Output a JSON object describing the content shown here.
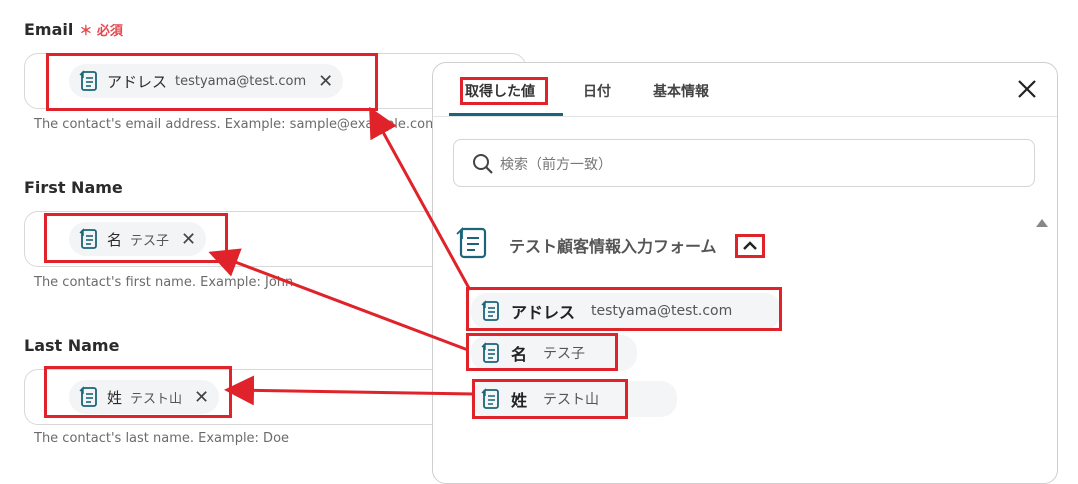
{
  "form": {
    "email": {
      "label": "Email",
      "required_mark": "＊ 必須",
      "chip_name": "アドレス",
      "chip_value": "testyama@test.com",
      "help": "The contact's email address. Example: sample@example.com"
    },
    "first_name": {
      "label": "First Name",
      "chip_name": "名",
      "chip_value": "テス子",
      "help": "The contact's first name. Example: John"
    },
    "last_name": {
      "label": "Last Name",
      "chip_name": "姓",
      "chip_value": "テスト山",
      "help": "The contact's last name. Example: Doe"
    }
  },
  "panel": {
    "tabs": [
      {
        "label": "取得した値",
        "active": true
      },
      {
        "label": "日付",
        "active": false
      },
      {
        "label": "基本情報",
        "active": false
      }
    ],
    "close_icon": "close-icon",
    "search_placeholder": "検索（前方一致）",
    "group": {
      "title": "テスト顧客情報入力フォーム",
      "items": [
        {
          "name": "アドレス",
          "value": "testyama@test.com"
        },
        {
          "name": "名",
          "value": "テス子"
        },
        {
          "name": "姓",
          "value": "テスト山"
        }
      ]
    }
  },
  "colors": {
    "annotation_red": "#e0222a",
    "accent_teal": "#1a6579",
    "required_red": "#e5484d"
  }
}
